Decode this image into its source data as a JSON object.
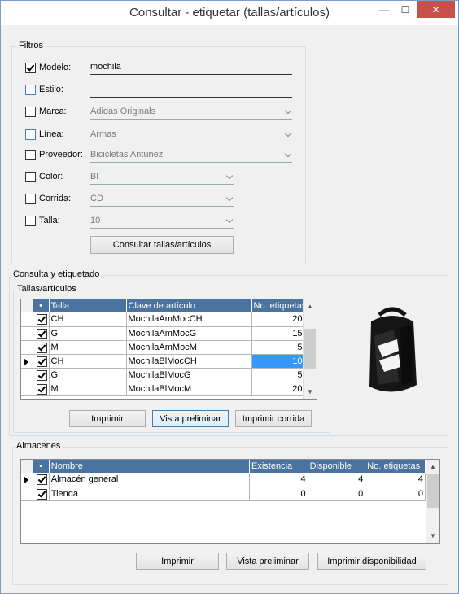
{
  "window": {
    "title": "Consultar - etiquetar  (tallas/artículos)",
    "min_glyph": "—",
    "max_glyph": "☐",
    "close_glyph": "✕"
  },
  "filtros": {
    "group_label": "Filtros",
    "modelo": {
      "label": "Modelo:",
      "value": "mochila",
      "checked": true
    },
    "estilo": {
      "label": "Estilo:",
      "value": "",
      "checked": false
    },
    "marca": {
      "label": "Marca:",
      "value": "Adidas Originals",
      "checked": false
    },
    "linea": {
      "label": "Línea:",
      "value": "Armas",
      "checked": false
    },
    "proveedor": {
      "label": "Proveedor:",
      "value": "Bicicletas Antunez",
      "checked": false
    },
    "color": {
      "label": "Color:",
      "value": "Bl",
      "checked": false
    },
    "corrida": {
      "label": "Corrida:",
      "value": "CD",
      "checked": false
    },
    "talla": {
      "label": "Talla:",
      "value": "10",
      "checked": false
    },
    "consultar_button": "Consultar tallas/artículos"
  },
  "consulta": {
    "group_label": "Consulta y etiquetado",
    "tallas_label": "Tallas/artículos",
    "columns": [
      "•",
      "Talla",
      "Clave de artículo",
      "No. etiquetas"
    ],
    "rows": [
      {
        "talla": "CH",
        "clave": "MochilaAmMocCH",
        "etiquetas": "20"
      },
      {
        "talla": "G",
        "clave": "MochilaAmMocG",
        "etiquetas": "15"
      },
      {
        "talla": "M",
        "clave": "MochilaAmMocM",
        "etiquetas": "5"
      },
      {
        "talla": "CH",
        "clave": "MochilaBlMocCH",
        "etiquetas": "10"
      },
      {
        "talla": "G",
        "clave": "MochilaBlMocG",
        "etiquetas": "5"
      },
      {
        "talla": "M",
        "clave": "MochilaBlMocM",
        "etiquetas": "20"
      }
    ],
    "imprimir": "Imprimir",
    "vista_preliminar": "Vista preliminar",
    "imprimir_corrida": "Imprimir corrida"
  },
  "almacenes": {
    "group_label": "Almacenes",
    "columns": [
      "•",
      "Nombre",
      "Existencia",
      "Disponible",
      "No. etiquetas"
    ],
    "rows": [
      {
        "nombre": "Almacén general",
        "existencia": "4",
        "disponible": "4",
        "etiquetas": "4"
      },
      {
        "nombre": "Tienda",
        "existencia": "0",
        "disponible": "0",
        "etiquetas": "0"
      }
    ],
    "imprimir": "Imprimir",
    "vista_preliminar": "Vista preliminar",
    "imprimir_disponibilidad": "Imprimir disponibilidad"
  },
  "icons": {
    "up": "▲",
    "down": "▼"
  },
  "colors": {
    "header": "#4a73a0",
    "selection": "#3399ff",
    "close": "#c7504c"
  }
}
